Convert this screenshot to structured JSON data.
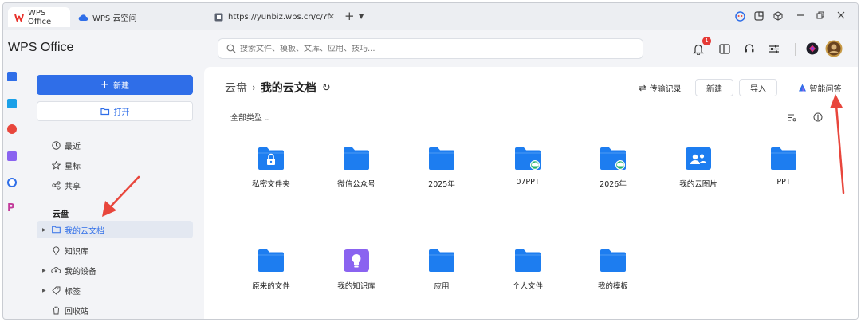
{
  "tabs": [
    {
      "label": "WPS Office",
      "icon": "wps-logo-icon",
      "active": true
    },
    {
      "label": "WPS 云空间",
      "icon": "cloud-icon",
      "active": false
    },
    {
      "label": "https://yunbiz.wps.cn/c/?f=right",
      "icon": "page-icon",
      "active": false
    }
  ],
  "header": {
    "app_title": "WPS Office",
    "search_placeholder": "搜索文件、模板、文库、应用、技巧...",
    "notification_count": "1"
  },
  "sidebar": {
    "new_label": "新建",
    "open_label": "打开",
    "nav_top": [
      {
        "label": "最近",
        "icon": "clock-icon"
      },
      {
        "label": "星标",
        "icon": "star-icon"
      },
      {
        "label": "共享",
        "icon": "share-icon"
      }
    ],
    "section_title": "云盘",
    "nav_cloud": [
      {
        "label": "我的云文档",
        "icon": "folder-outline-icon",
        "active": true,
        "caret": true
      },
      {
        "label": "知识库",
        "icon": "bulb-icon",
        "active": false,
        "caret": false
      },
      {
        "label": "我的设备",
        "icon": "cloud-device-icon",
        "active": false,
        "caret": true
      },
      {
        "label": "标签",
        "icon": "tag-icon",
        "active": false,
        "caret": true
      },
      {
        "label": "回收站",
        "icon": "trash-icon",
        "active": false,
        "caret": false
      }
    ]
  },
  "main": {
    "breadcrumb_root": "云盘",
    "breadcrumb_current": "我的云文档",
    "transfer_label": "传输记录",
    "new_label": "新建",
    "import_label": "导入",
    "ai_label": "智能问答",
    "filter_label": "全部类型",
    "items": [
      {
        "label": "私密文件夹",
        "kind": "private"
      },
      {
        "label": "微信公众号",
        "kind": "folder"
      },
      {
        "label": "2025年",
        "kind": "folder"
      },
      {
        "label": "07PPT",
        "kind": "synced"
      },
      {
        "label": "2026年",
        "kind": "synced"
      },
      {
        "label": "我的云图片",
        "kind": "people"
      },
      {
        "label": "PPT",
        "kind": "folder"
      },
      {
        "label": "原来的文件",
        "kind": "folder"
      },
      {
        "label": "我的知识库",
        "kind": "knowledge"
      },
      {
        "label": "应用",
        "kind": "folder"
      },
      {
        "label": "个人文件",
        "kind": "folder"
      },
      {
        "label": "我的模板",
        "kind": "folder"
      }
    ]
  },
  "colors": {
    "accent": "#2f6ee8",
    "folder": "#1d7df0",
    "knowledge": "#8a63f0",
    "annotation": "#e8463c"
  }
}
